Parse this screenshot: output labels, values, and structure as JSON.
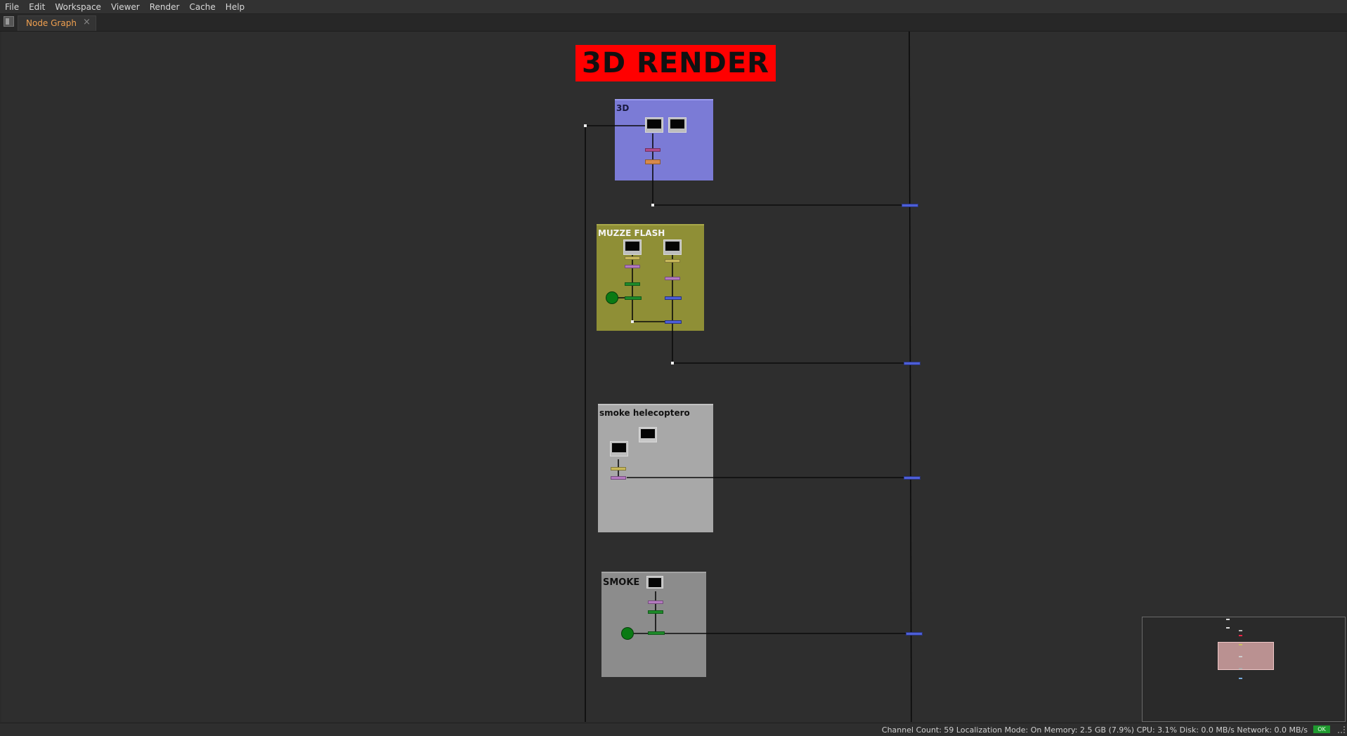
{
  "menubar": {
    "items": [
      "File",
      "Edit",
      "Workspace",
      "Viewer",
      "Render",
      "Cache",
      "Help"
    ]
  },
  "tabs": [
    {
      "label": "Node Graph",
      "close": "×",
      "active": true
    }
  ],
  "graph": {
    "sticky_note": {
      "text": "3D RENDER",
      "color": "#ff0000"
    },
    "backdrops": [
      {
        "label": "3D",
        "color": "#7b7bd6"
      },
      {
        "label": "MUZZE FLASH",
        "color": "#8f8f36"
      },
      {
        "label": "smoke helecoptero",
        "color": "#a8a8a8"
      },
      {
        "label": "SMOKE",
        "color": "#8c8c8c"
      }
    ]
  },
  "status": {
    "text": "Channel Count: 59  Localization Mode: On  Memory: 2.5 GB (7.9%)  CPU: 3.1%  Disk: 0.0 MB/s  Network: 0.0 MB/s",
    "badge": "OK"
  },
  "colors": {
    "accent": "#f0a050",
    "merge_node": "#4d5fd8",
    "dot_node": "#0a7a14"
  }
}
